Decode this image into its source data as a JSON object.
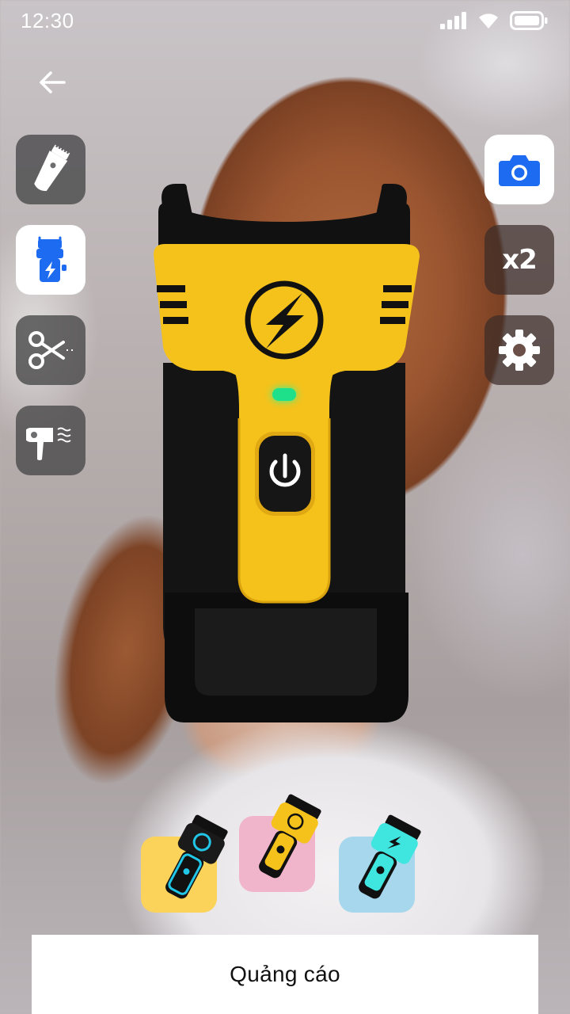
{
  "status_bar": {
    "time": "12:30",
    "icons": [
      "signal-icon",
      "wifi-icon",
      "battery-icon"
    ]
  },
  "navigation": {
    "back_icon": "arrow-left-icon"
  },
  "left_tools": [
    {
      "id": "trimmer",
      "icon": "hair-trimmer-icon",
      "active": false
    },
    {
      "id": "taser",
      "icon": "taser-icon",
      "active": true
    },
    {
      "id": "scissors",
      "icon": "scissors-icon",
      "active": false
    },
    {
      "id": "hair-dryer",
      "icon": "hair-dryer-icon",
      "active": false
    }
  ],
  "right_tools": {
    "camera_icon": "camera-icon",
    "multiplier_label": "x2",
    "settings_icon": "gear-icon"
  },
  "device": {
    "name_icon": "lightning-icon",
    "power_icon": "power-icon",
    "led_color": "#1ee08a",
    "body_color": "#f5c21b",
    "frame_color": "#111111"
  },
  "skins": [
    {
      "id": "skin-blue",
      "bg": "#fbd25a",
      "accent": "#22c6e6"
    },
    {
      "id": "skin-yellow",
      "bg": "#f0b4cb",
      "accent": "#f5c21b"
    },
    {
      "id": "skin-cyan",
      "bg": "#a7d7ec",
      "accent": "#3fe6e0"
    }
  ],
  "colors": {
    "accent_blue": "#1d6bf0",
    "tool_bg": "#464648"
  },
  "ad": {
    "label": "Quảng cáo"
  }
}
